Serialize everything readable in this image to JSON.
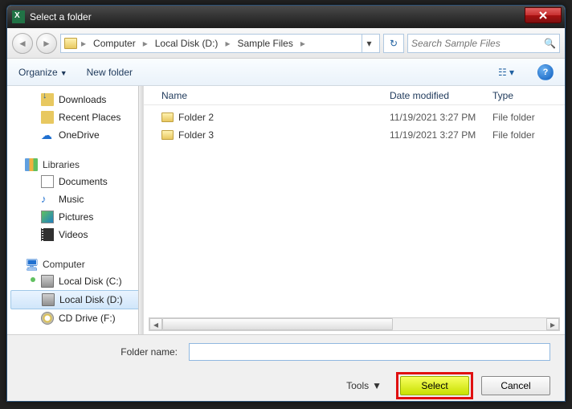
{
  "titlebar": {
    "title": "Select a folder"
  },
  "breadcrumb": {
    "items": [
      "Computer",
      "Local Disk (D:)",
      "Sample Files"
    ]
  },
  "search": {
    "placeholder": "Search Sample Files"
  },
  "toolbar": {
    "organize": "Organize",
    "new_folder": "New folder"
  },
  "sidebar": {
    "quick": [
      {
        "label": "Downloads",
        "icon": "download"
      },
      {
        "label": "Recent Places",
        "icon": "recent"
      },
      {
        "label": "OneDrive",
        "icon": "onedrive"
      }
    ],
    "libraries_label": "Libraries",
    "libraries": [
      {
        "label": "Documents",
        "icon": "doc"
      },
      {
        "label": "Music",
        "icon": "music"
      },
      {
        "label": "Pictures",
        "icon": "pic"
      },
      {
        "label": "Videos",
        "icon": "vid"
      }
    ],
    "computer_label": "Computer",
    "drives": [
      {
        "label": "Local Disk (C:)",
        "icon": "disk-c"
      },
      {
        "label": "Local Disk (D:)",
        "icon": "disk",
        "selected": true
      },
      {
        "label": "CD Drive (F:)",
        "icon": "cd"
      }
    ]
  },
  "filelist": {
    "columns": {
      "name": "Name",
      "date": "Date modified",
      "type": "Type"
    },
    "rows": [
      {
        "name": "Folder 2",
        "date": "11/19/2021 3:27 PM",
        "type": "File folder"
      },
      {
        "name": "Folder 3",
        "date": "11/19/2021 3:27 PM",
        "type": "File folder"
      }
    ]
  },
  "bottom": {
    "folder_name_label": "Folder name:",
    "folder_name_value": "",
    "tools_label": "Tools",
    "select_label": "Select",
    "cancel_label": "Cancel"
  }
}
